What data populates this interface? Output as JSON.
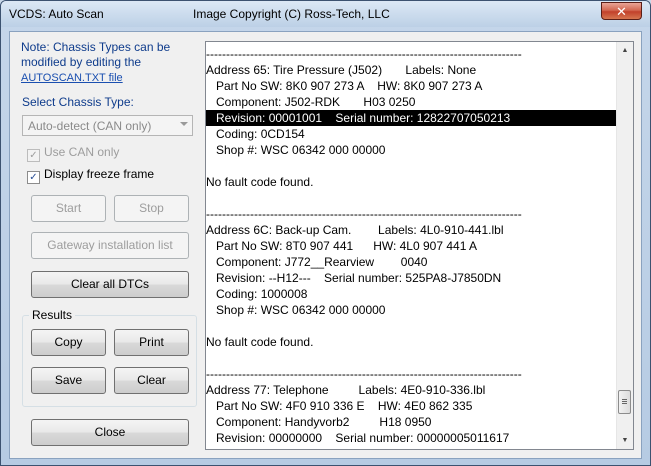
{
  "window": {
    "title": "VCDS:  Auto Scan",
    "copyright": "Image Copyright (C) Ross-Tech, LLC",
    "close_glyph": "✕"
  },
  "note": {
    "text": "Note:  Chassis Types can be modified by editing the",
    "link": "AUTOSCAN.TXT file"
  },
  "chassis": {
    "label": "Select Chassis Type:",
    "selected": "Auto-detect (CAN only)"
  },
  "options": {
    "use_can": {
      "label": "Use CAN only",
      "checked": true,
      "disabled": true
    },
    "freeze_frame": {
      "label": "Display freeze frame",
      "checked": true
    }
  },
  "buttons": {
    "start": "Start",
    "stop": "Stop",
    "gateway": "Gateway installation list",
    "clear_all": "Clear all DTCs",
    "copy": "Copy",
    "print": "Print",
    "save": "Save",
    "clear": "Clear",
    "close": "Close"
  },
  "results": {
    "label": "Results"
  },
  "log": {
    "lines": [
      "-------------------------------------------------------------------------------",
      "Address 65: Tire Pressure (J502)       Labels: None",
      "   Part No SW: 8K0 907 273 A    HW: 8K0 907 273 A",
      "   Component: J502-RDK       H03 0250",
      "   Revision: 00001001    Serial number: 12822707050213",
      "   Coding: 0CD154",
      "   Shop #: WSC 06342 000 00000",
      "",
      "No fault code found.",
      "",
      "-------------------------------------------------------------------------------",
      "Address 6C: Back-up Cam.        Labels: 4L0-910-441.lbl",
      "   Part No SW: 8T0 907 441      HW: 4L0 907 441 A",
      "   Component: J772__Rearview        0040",
      "   Revision: --H12---    Serial number: 525PA8-J7850DN",
      "   Coding: 1000008",
      "   Shop #: WSC 06342 000 00000",
      "",
      "No fault code found.",
      "",
      "-------------------------------------------------------------------------------",
      "Address 77: Telephone         Labels: 4E0-910-336.lbl",
      "   Part No SW: 4F0 910 336 E    HW: 4E0 862 335",
      "   Component: Handyvorb2         H18 0950",
      "   Revision: 00000000    Serial number: 00000005011617"
    ],
    "selected_line": "4"
  },
  "scrollbar": {
    "up": "▲",
    "down": "▼",
    "position": 0.92
  }
}
